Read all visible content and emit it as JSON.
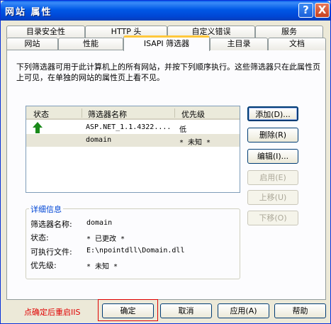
{
  "window": {
    "title": "网站 属性",
    "help_icon": "?",
    "close_icon": "X"
  },
  "tabs_row1": [
    "目录安全性",
    "HTTP 头",
    "自定义错误",
    "服务"
  ],
  "tabs_row2": [
    "网站",
    "性能",
    "ISAPI 筛选器",
    "主目录",
    "文档"
  ],
  "active_tab": "ISAPI 筛选器",
  "description": "下列筛选器可用于此计算机上的所有网站，并按下列顺序执行。这些筛选器只在此属性页上可见，在单独的网站的属性页上看不见。",
  "list": {
    "headers": {
      "status": "状态",
      "name": "筛选器名称",
      "priority": "优先级"
    },
    "rows": [
      {
        "status": "loaded-arrow",
        "name": "ASP.NET_1.1.4322....",
        "priority": "低"
      },
      {
        "status": "",
        "name": "domain",
        "priority": "* 未知 *"
      }
    ]
  },
  "side_buttons": {
    "add": "添加(D)...",
    "remove": "删除(R)",
    "edit": "编辑(I)...",
    "enable": "启用(E)",
    "move_up": "上移(U)",
    "move_down": "下移(O)"
  },
  "details": {
    "title": "详细信息",
    "name_label": "筛选器名称:",
    "name_value": "domain",
    "status_label": "状态:",
    "status_value": "* 已更改 *",
    "exe_label": "可执行文件:",
    "exe_value": "E:\\npointdll\\Domain.dll",
    "priority_label": "优先级:",
    "priority_value": "* 未知 *"
  },
  "footer": {
    "note": "点确定后重启IIS",
    "ok": "确定",
    "cancel": "取消",
    "apply": "应用(A)",
    "help": "帮助"
  },
  "colors": {
    "note_red": "#e00000",
    "arrow_green": "#1a8a1a"
  }
}
